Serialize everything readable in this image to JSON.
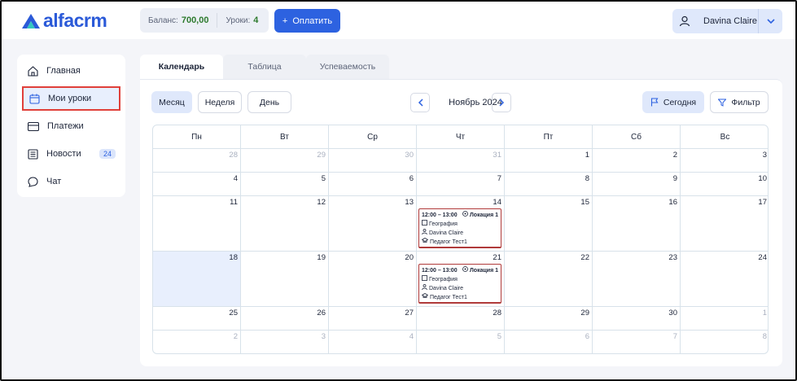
{
  "header": {
    "logo_text": "alfacrm",
    "balance_label": "Баланс:",
    "balance_value": "700,00",
    "lessons_label": "Уроки:",
    "lessons_value": "4",
    "pay_button": "Оплатить",
    "user_name": "Davina Claire"
  },
  "sidebar": {
    "items": [
      {
        "label": "Главная",
        "icon": "home-icon"
      },
      {
        "label": "Мои уроки",
        "icon": "calendar-icon"
      },
      {
        "label": "Платежи",
        "icon": "card-icon"
      },
      {
        "label": "Новости",
        "icon": "news-icon",
        "badge": "24"
      },
      {
        "label": "Чат",
        "icon": "chat-icon"
      }
    ]
  },
  "tabs": [
    "Календарь",
    "Таблица",
    "Успеваемость"
  ],
  "toolbar": {
    "month_btn": "Месяц",
    "week_btn": "Неделя",
    "day_btn": "День",
    "period_label": "Ноябрь 2024",
    "today_btn": "Сегодня",
    "filter_btn": "Фильтр"
  },
  "calendar": {
    "weekdays": [
      "Пн",
      "Вт",
      "Ср",
      "Чт",
      "Пт",
      "Сб",
      "Вс"
    ],
    "weeks": [
      [
        "28",
        "29",
        "30",
        "31",
        "1",
        "2",
        "3"
      ],
      [
        "4",
        "5",
        "6",
        "7",
        "8",
        "9",
        "10"
      ],
      [
        "11",
        "12",
        "13",
        "14",
        "15",
        "16",
        "17"
      ],
      [
        "18",
        "19",
        "20",
        "21",
        "22",
        "23",
        "24"
      ],
      [
        "25",
        "26",
        "27",
        "28",
        "29",
        "30",
        "1"
      ],
      [
        "2",
        "3",
        "4",
        "5",
        "6",
        "7",
        "8"
      ]
    ],
    "events": [
      {
        "time": "12:00 – 13:00",
        "location": "Локация 1",
        "subject": "География",
        "student": "Davina Claire",
        "teacher": "Педагог Тест1"
      },
      {
        "time": "12:00 – 13:00",
        "location": "Локация 1",
        "subject": "География",
        "student": "Davina Claire",
        "teacher": "Педагог Тест1"
      }
    ]
  }
}
